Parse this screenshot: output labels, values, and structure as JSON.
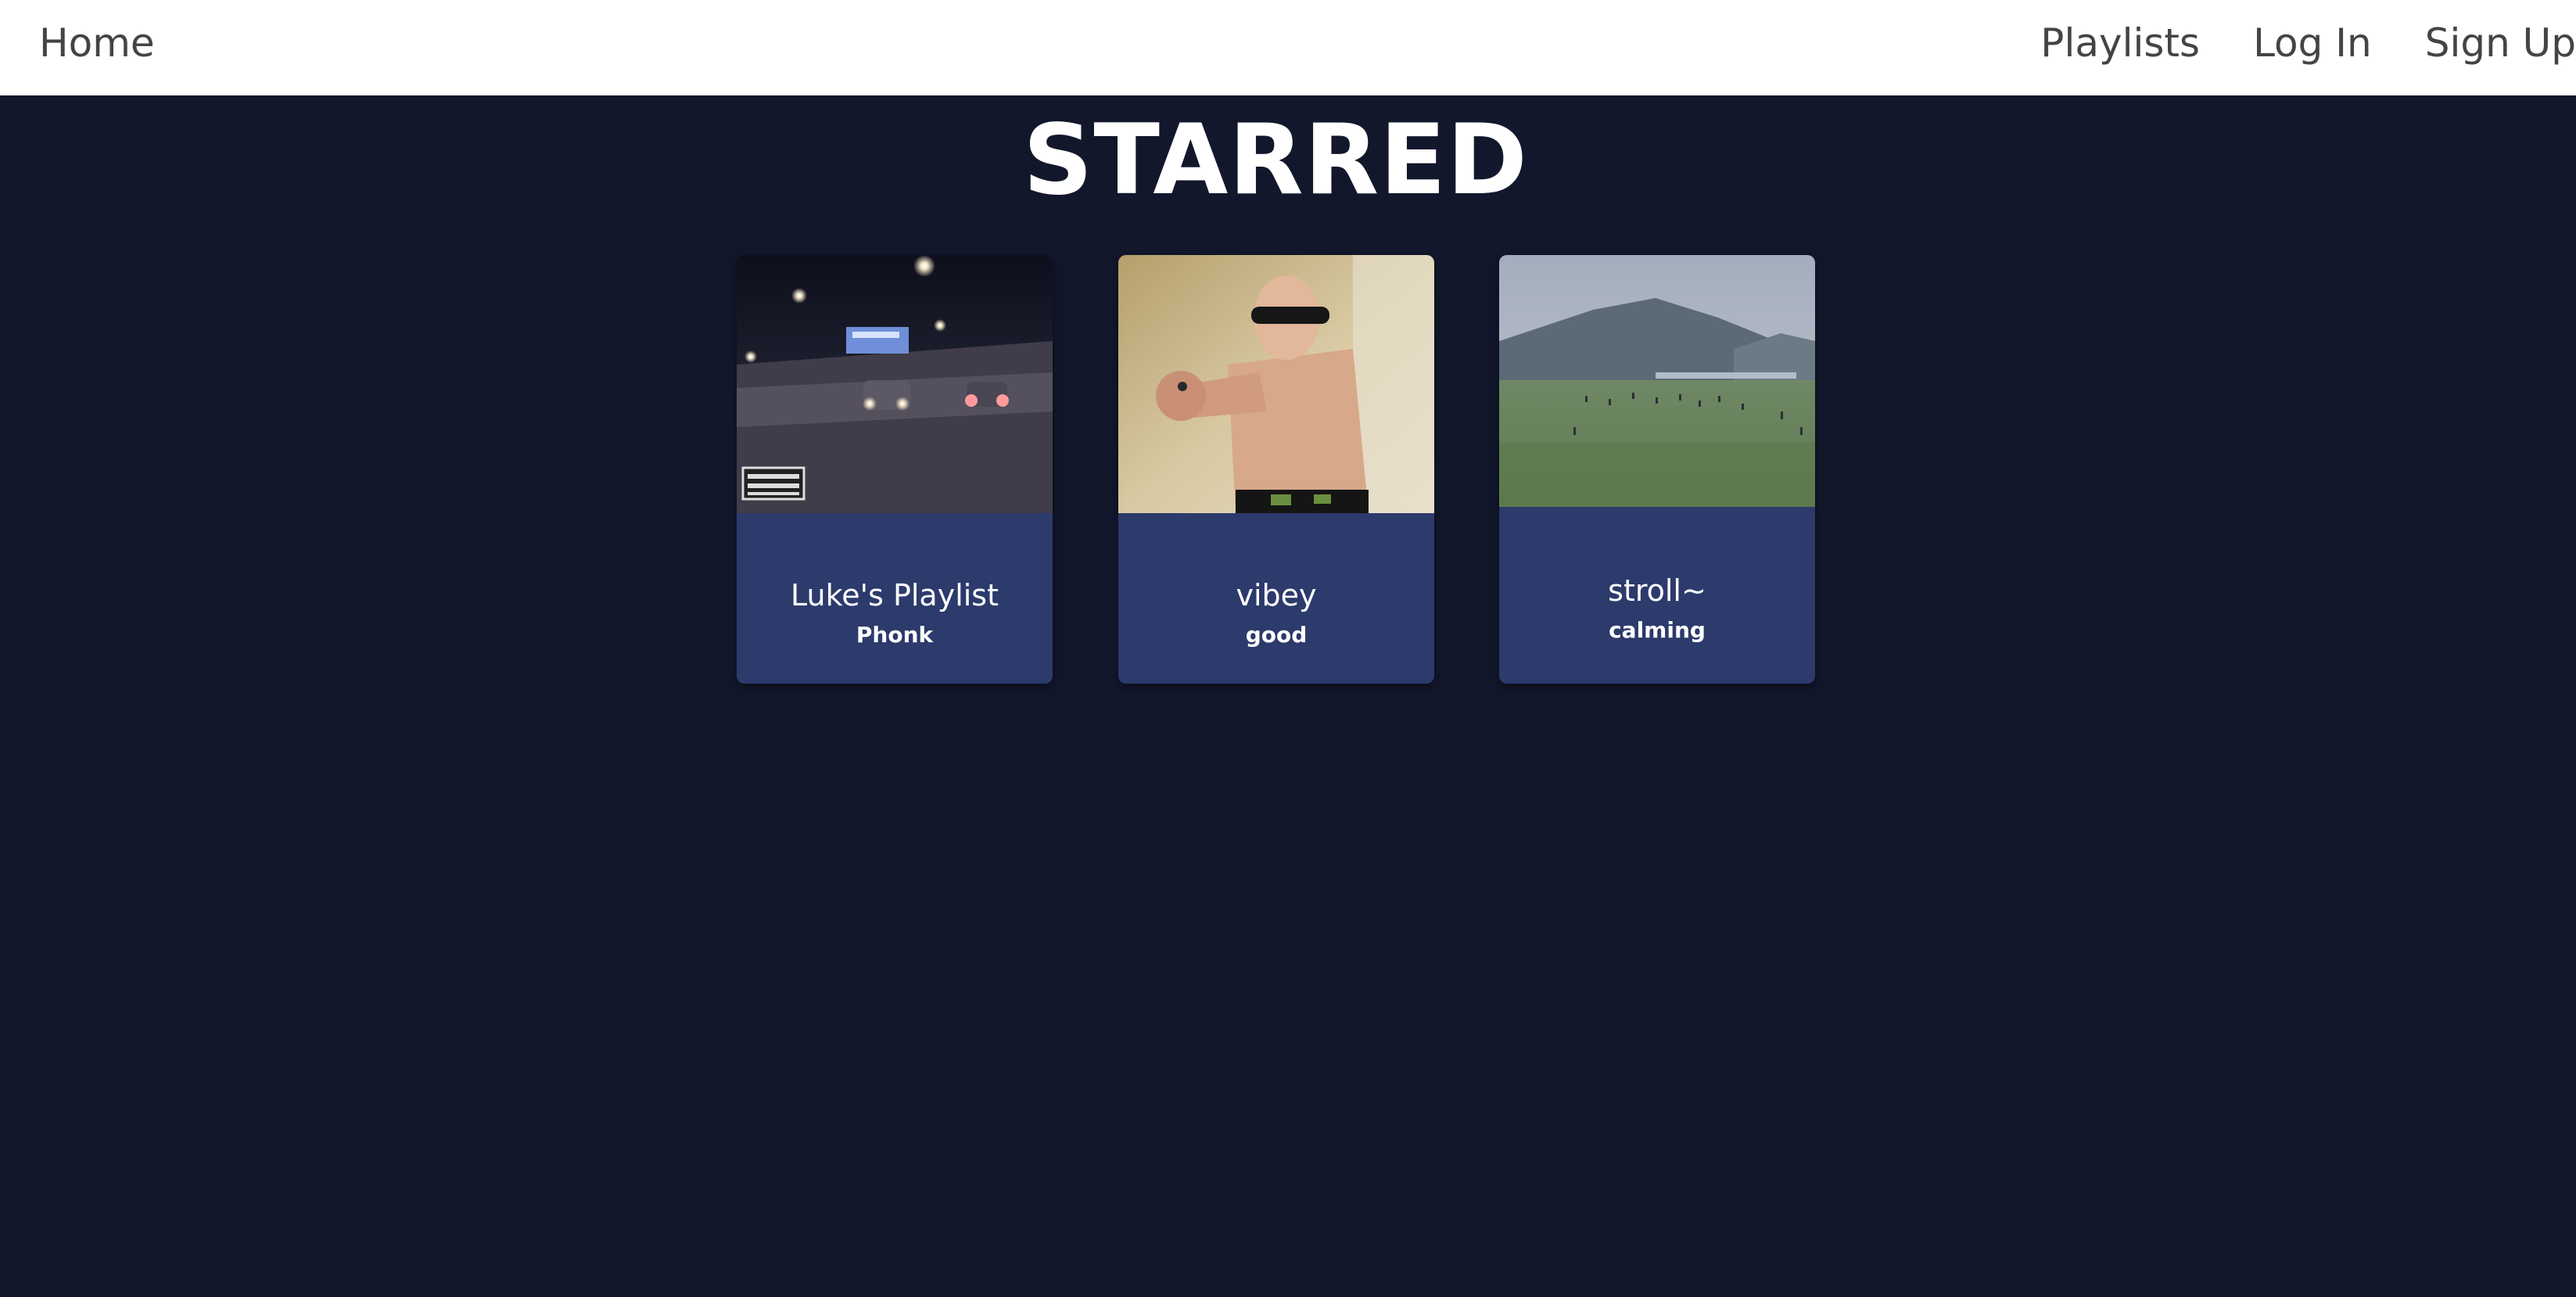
{
  "nav": {
    "home": "Home",
    "playlists": "Playlists",
    "login": "Log In",
    "signup": "Sign Up"
  },
  "page": {
    "title": "STARRED"
  },
  "playlists": [
    {
      "title": "Luke's Playlist",
      "genre": "Phonk",
      "image": "night-highway-cars-photo"
    },
    {
      "title": "vibey",
      "genre": "good",
      "image": "man-pointing-sunglasses-photo"
    },
    {
      "title": "stroll~",
      "genre": "calming",
      "image": "green-field-mountain-photo"
    }
  ],
  "colors": {
    "background": "#12172c",
    "nav_background": "#ffffff",
    "nav_text": "#444444",
    "card_background": "#2c3a6c",
    "text": "#ffffff"
  }
}
